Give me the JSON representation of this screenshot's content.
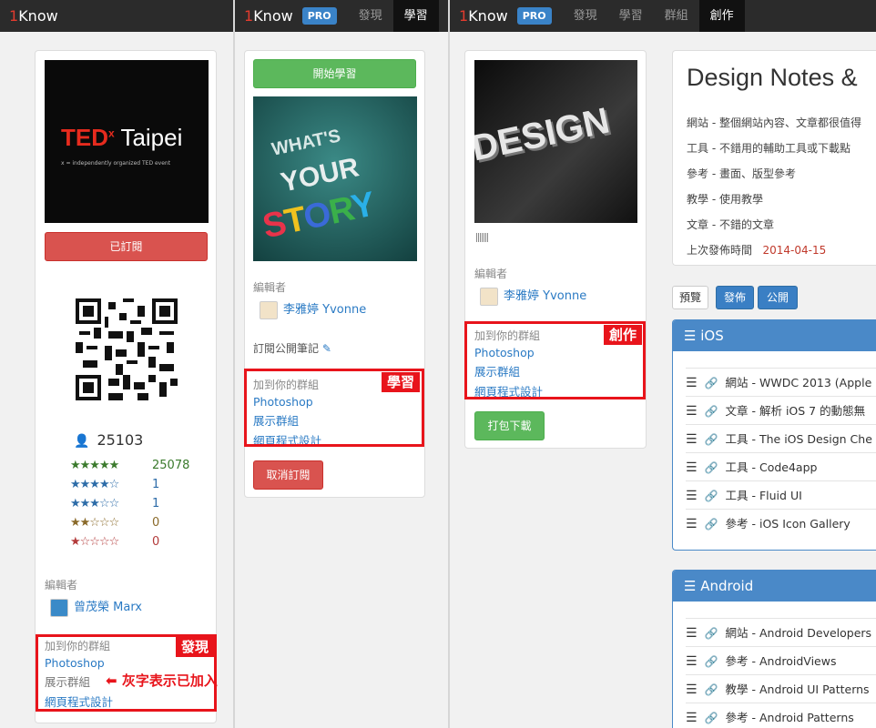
{
  "p1": {
    "logo_prefix": "1",
    "logo_name": "Know",
    "subscribed_button": "已訂閱",
    "cover_brand": "TEDxTaipei",
    "cover_tagline": "x = independently organized TED event",
    "subscribers": "25103",
    "ratings": [
      {
        "stars": "★★★★★",
        "count": "25078",
        "color": "#3a7a2c"
      },
      {
        "stars": "★★★★☆",
        "count": "1",
        "color": "#2d6ca8"
      },
      {
        "stars": "★★★☆☆",
        "count": "1",
        "color": "#2d6ca8"
      },
      {
        "stars": "★★☆☆☆",
        "count": "0",
        "color": "#8a6a2a"
      },
      {
        "stars": "★☆☆☆☆",
        "count": "0",
        "color": "#b33b3b"
      }
    ],
    "editor_label": "編輯者",
    "editor_name": "曾茂榮 Marx",
    "group_heading": "加到你的群組",
    "groups": [
      "Photoshop",
      "展示群組",
      "網頁程式設計"
    ],
    "callout_label": "發現",
    "annotation": "灰字表示已加入"
  },
  "p2": {
    "logo_prefix": "1",
    "logo_name": "Know",
    "pro": "PRO",
    "nav": [
      "發現",
      "學習"
    ],
    "start_button": "開始學習",
    "cover_words": [
      "WHAT'S",
      "YOUR",
      "STORY"
    ],
    "editor_label": "編輯者",
    "editor_name": "李雅婷 Yvonne",
    "subscribe_notes": "訂閱公開筆記",
    "group_heading": "加到你的群組",
    "groups": [
      "Photoshop",
      "展示群組",
      "網頁程式設計"
    ],
    "callout_label": "學習",
    "unsubscribe_button": "取消訂閱"
  },
  "p3": {
    "logo_prefix": "1",
    "logo_name": "Know",
    "pro": "PRO",
    "nav": [
      "發現",
      "學習",
      "群組",
      "創作"
    ],
    "cover_word": "DESIGN",
    "editor_label": "編輯者",
    "editor_name": "李雅婷 Yvonne",
    "group_heading": "加到你的群組",
    "groups": [
      "Photoshop",
      "展示群組",
      "網頁程式設計"
    ],
    "callout_label": "創作",
    "pack_button": "打包下載",
    "title": "Design Notes &",
    "legend": [
      "網站 - 整個網站內容、文章都很值得",
      "工具 - 不錯用的輔助工具或下載點",
      "參考 - 畫面、版型參考",
      "教學 - 使用教學",
      "文章 - 不錯的文章"
    ],
    "last_publish_label": "上次發佈時間",
    "last_publish_date": "2014-04-15",
    "actions": [
      "預覽",
      "發佈",
      "公開"
    ],
    "sections": [
      {
        "name": "iOS",
        "items": [
          "網站 - WWDC 2013 (Apple",
          "文章 - 解析 iOS 7 的動態無",
          "工具 - The iOS Design Che",
          "工具 - Code4app",
          "工具 - Fluid UI",
          "參考 - iOS Icon Gallery"
        ]
      },
      {
        "name": "Android",
        "items": [
          "網站 - Android Developers",
          "參考 - AndroidViews",
          "教學 - Android UI Patterns",
          "參考 - Android Patterns"
        ]
      }
    ]
  },
  "colors": {
    "accent": "#4a89c8",
    "danger": "#d9534f",
    "success": "#5cb85c",
    "callout": "#e8141b"
  }
}
